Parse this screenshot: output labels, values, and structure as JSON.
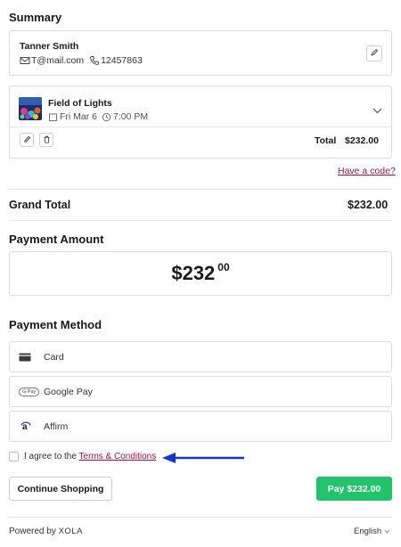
{
  "summary": {
    "title": "Summary",
    "customer": {
      "name": "Tanner Smith",
      "email": "T@mail.com",
      "phone": "12457863"
    },
    "event": {
      "name": "Field of Lights",
      "date": "Fri Mar 6",
      "time": "7:00 PM",
      "total_label": "Total",
      "total_value": "$232.00"
    },
    "promo_link": "Have a code?"
  },
  "grand_total": {
    "label": "Grand Total",
    "value": "$232.00"
  },
  "payment_amount": {
    "title": "Payment Amount",
    "dollars": "$232",
    "cents": "00"
  },
  "payment_method": {
    "title": "Payment Method",
    "options": [
      {
        "label": "Card",
        "icon": "credit-card-icon"
      },
      {
        "label": "Google Pay",
        "icon": "google-pay-icon",
        "icon_text": "G Pay"
      },
      {
        "label": "Affirm",
        "icon": "affirm-icon",
        "icon_text": "a"
      }
    ]
  },
  "agreement": {
    "prefix": "I agree to the",
    "link": "Terms & Conditions"
  },
  "actions": {
    "continue": "Continue Shopping",
    "pay": "Pay $232.00"
  },
  "footer": {
    "powered_by": "Powered by",
    "brand": "XOLA",
    "language": "English"
  },
  "colors": {
    "pay_button": "#22c36a",
    "link": "#a5123c",
    "arrow": "#1036d6"
  }
}
